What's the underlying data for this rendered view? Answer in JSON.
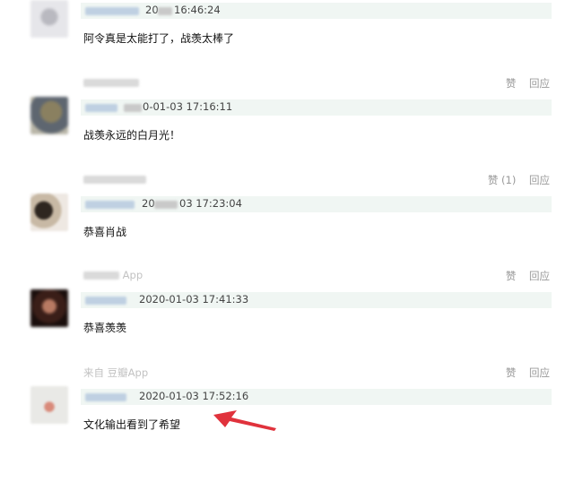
{
  "comments": [
    {
      "date_prefix": "20",
      "time_suffix": "16:46:24",
      "text": "阿令真是太能打了，战羡太棒了"
    },
    {
      "source": "",
      "like_label": "赞",
      "reply_label": "回应",
      "time_suffix": "0-01-03 17:16:11",
      "text": "战羡永远的白月光！"
    },
    {
      "source": "",
      "like_label": "赞 (1)",
      "reply_label": "回应",
      "date_prefix": "20",
      "time_suffix": "03 17:23:04",
      "text": "恭喜肖战"
    },
    {
      "source": "App",
      "like_label": "赞",
      "reply_label": "回应",
      "time_suffix": "2020-01-03 17:41:33",
      "text": "恭喜羡羡"
    },
    {
      "source": "来自 豆瓣App",
      "like_label": "赞",
      "reply_label": "回应",
      "time_suffix": "2020-01-03 17:52:16",
      "text": "文化输出看到了希望"
    }
  ],
  "colors": {
    "meta_bar": "#f0f6f3",
    "arrow": "#e0323c",
    "secondary_text": "#999999"
  }
}
